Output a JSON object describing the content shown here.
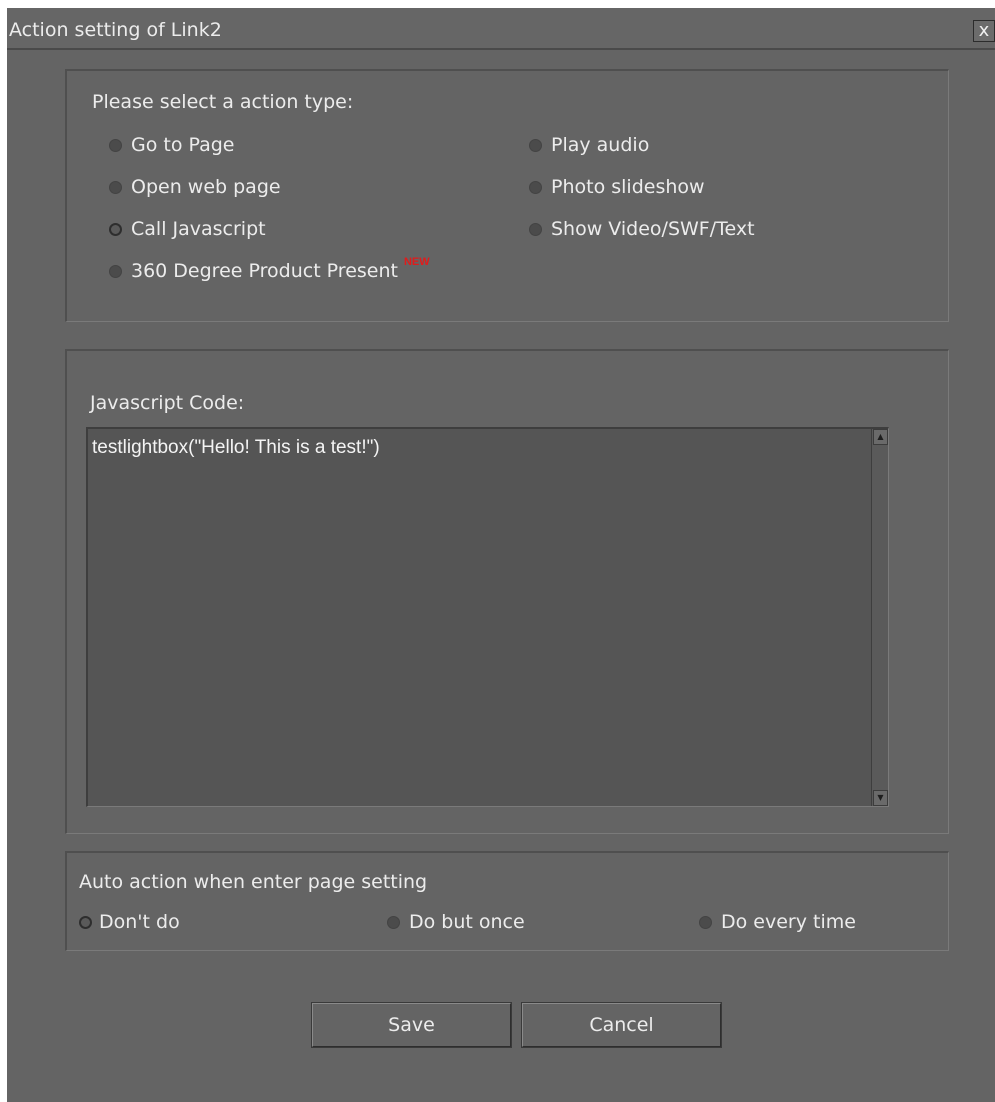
{
  "window": {
    "title": "Action setting of Link2",
    "close_label": "x"
  },
  "action_type": {
    "label": "Please select a action type:",
    "options": [
      {
        "label": "Go to Page",
        "checked": false
      },
      {
        "label": "Open web page",
        "checked": false
      },
      {
        "label": "Call Javascript",
        "checked": true
      },
      {
        "label": "360 Degree Product Present",
        "checked": false,
        "badge": "NEW"
      },
      {
        "label": "Play audio",
        "checked": false
      },
      {
        "label": "Photo slideshow",
        "checked": false
      },
      {
        "label": "Show Video/SWF/Text",
        "checked": false
      }
    ]
  },
  "javascript": {
    "label": "Javascript Code:",
    "code": "testlightbox(\"Hello! This is a test!\")"
  },
  "auto_action": {
    "label": "Auto action when enter page setting",
    "options": [
      {
        "label": "Don't do",
        "checked": true
      },
      {
        "label": "Do but once",
        "checked": false
      },
      {
        "label": "Do every time",
        "checked": false
      }
    ]
  },
  "buttons": {
    "save_label": "Save",
    "cancel_label": "Cancel"
  },
  "colors": {
    "background": "#646464",
    "badge": "#e11b1b"
  }
}
